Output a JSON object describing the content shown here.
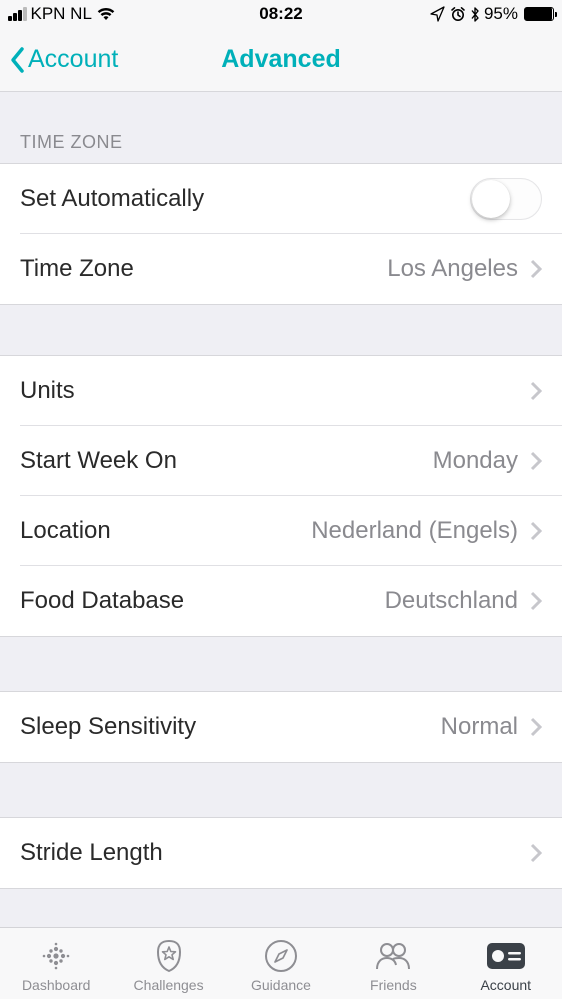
{
  "status": {
    "carrier": "KPN NL",
    "time": "08:22",
    "battery_pct": "95%"
  },
  "nav": {
    "back_label": "Account",
    "title": "Advanced"
  },
  "sections": {
    "timezone_header": "TIME ZONE",
    "set_auto": {
      "label": "Set Automatically",
      "on": false
    },
    "time_zone": {
      "label": "Time Zone",
      "value": "Los Angeles"
    },
    "units": {
      "label": "Units",
      "value": ""
    },
    "start_week": {
      "label": "Start Week On",
      "value": "Monday"
    },
    "location": {
      "label": "Location",
      "value": "Nederland (Engels)"
    },
    "food_db": {
      "label": "Food Database",
      "value": "Deutschland"
    },
    "sleep": {
      "label": "Sleep Sensitivity",
      "value": "Normal"
    },
    "stride": {
      "label": "Stride Length",
      "value": ""
    }
  },
  "tabs": {
    "dashboard": "Dashboard",
    "challenges": "Challenges",
    "guidance": "Guidance",
    "friends": "Friends",
    "account": "Account"
  }
}
